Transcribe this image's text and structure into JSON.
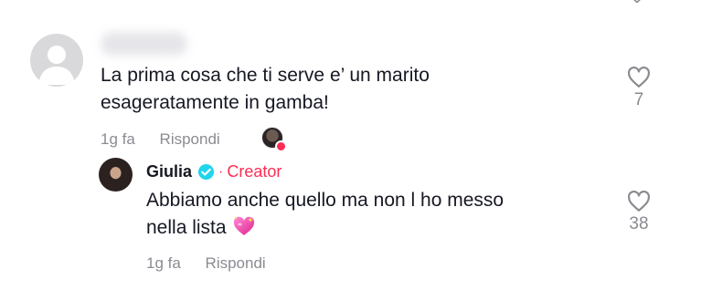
{
  "comments": [
    {
      "text_line1": "La prima cosa che ti serve e’ un marito",
      "text_line2": "esageratamente in gamba!",
      "time": "1g fa",
      "reply_label": "Rispondi",
      "likes": "7",
      "creator_liked": true
    }
  ],
  "reply": {
    "username": "Giulia",
    "dot": "·",
    "badge": "Creator",
    "text_line1": "Abbiamo anche quello ma non l ho messo",
    "text_line2": "nella lista",
    "emoji": "sparkling-heart",
    "time": "1g fa",
    "reply_label": "Rispondi",
    "likes": "38"
  },
  "colors": {
    "accent": "#fe2c55",
    "verified": "#20d5ec",
    "muted": "#8a8b91",
    "text": "#161823"
  }
}
